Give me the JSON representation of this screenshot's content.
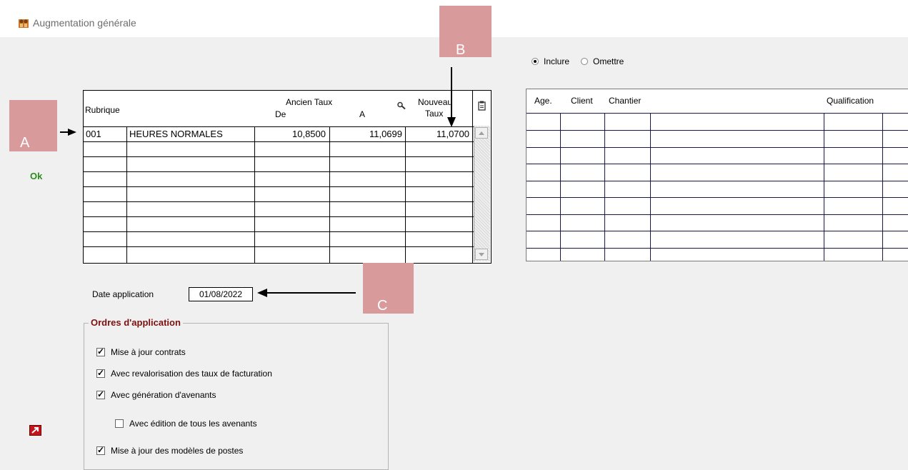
{
  "window": {
    "title": "Augmentation générale",
    "icon": "people-icon"
  },
  "ok_label": "Ok",
  "exit_icon": "exit-arrow-icon",
  "left_grid": {
    "headers": {
      "rubrique": "Rubrique",
      "ancien_taux": "Ancien Taux",
      "de": "De",
      "a": "A",
      "nouveau": "Nouveau",
      "taux": "Taux"
    },
    "rows": [
      {
        "code": "001",
        "label": "HEURES NORMALES",
        "de": "10,8500",
        "a": "11,0699",
        "nouveau": "11,0700"
      }
    ]
  },
  "filter": {
    "inclure": "Inclure",
    "omettre": "Omettre",
    "selected": "Inclure"
  },
  "right_grid": {
    "headers": {
      "age": "Age.",
      "client": "Client",
      "chantier": "Chantier",
      "qualification": "Qualification"
    }
  },
  "date": {
    "label": "Date application",
    "value": "01/08/2022"
  },
  "orders": {
    "title": "Ordres d'application",
    "items": [
      {
        "label": "Mise à jour contrats",
        "checked": true
      },
      {
        "label": "Avec revalorisation des taux de facturation",
        "checked": true
      },
      {
        "label": "Avec génération d'avenants",
        "checked": true
      },
      {
        "label": "Avec édition de tous les avenants",
        "checked": false
      },
      {
        "label": "Mise à jour des modèles de postes",
        "checked": true
      }
    ]
  },
  "callouts": {
    "a": "A",
    "b": "B",
    "c": "C"
  },
  "colors": {
    "callout": "#d99a9c",
    "ok": "#2a8f1a",
    "group_title": "#7b1010"
  }
}
